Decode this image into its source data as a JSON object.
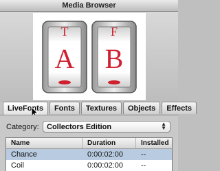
{
  "window": {
    "title": "Media Browser"
  },
  "preview": {
    "letters": [
      "A",
      "B"
    ]
  },
  "tabs": [
    {
      "label": "LiveFonts",
      "active": true
    },
    {
      "label": "Fonts",
      "active": false
    },
    {
      "label": "Textures",
      "active": false
    },
    {
      "label": "Objects",
      "active": false
    },
    {
      "label": "Effects",
      "active": false
    }
  ],
  "category": {
    "label": "Category:",
    "value": "Collectors Edition"
  },
  "table": {
    "columns": [
      "Name",
      "Duration",
      "Installed"
    ],
    "rows": [
      {
        "name": "Chance",
        "duration": "0:00:02:00",
        "installed": "--",
        "selected": true
      },
      {
        "name": "Coil",
        "duration": "0:00:02:00",
        "installed": "--",
        "selected": false
      }
    ]
  },
  "colors": {
    "selection": "#b8cbe0",
    "letter_red": "#d02030"
  }
}
